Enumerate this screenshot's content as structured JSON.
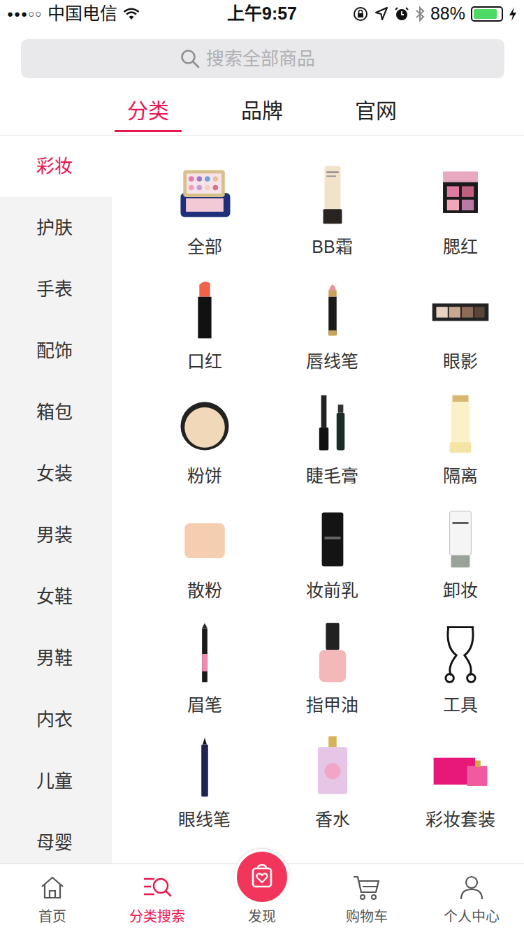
{
  "status_bar": {
    "signal": "●●●○○",
    "carrier": "中国电信",
    "time": "上午9:57",
    "battery": "88%",
    "battery_level": 0.88
  },
  "search": {
    "placeholder": "搜索全部商品"
  },
  "tabs": [
    {
      "label": "分类",
      "selected": true
    },
    {
      "label": "品牌",
      "selected": false
    },
    {
      "label": "官网",
      "selected": false
    }
  ],
  "sidebar": {
    "items": [
      {
        "label": "彩妆",
        "selected": true
      },
      {
        "label": "护肤",
        "selected": false
      },
      {
        "label": "手表",
        "selected": false
      },
      {
        "label": "配饰",
        "selected": false
      },
      {
        "label": "箱包",
        "selected": false
      },
      {
        "label": "女装",
        "selected": false
      },
      {
        "label": "男装",
        "selected": false
      },
      {
        "label": "女鞋",
        "selected": false
      },
      {
        "label": "男鞋",
        "selected": false
      },
      {
        "label": "内衣",
        "selected": false
      },
      {
        "label": "儿童",
        "selected": false
      },
      {
        "label": "母婴",
        "selected": false
      }
    ]
  },
  "categories": [
    {
      "label": "全部"
    },
    {
      "label": "BB霜"
    },
    {
      "label": "腮红"
    },
    {
      "label": "口红"
    },
    {
      "label": "唇线笔"
    },
    {
      "label": "眼影"
    },
    {
      "label": "粉饼"
    },
    {
      "label": "睫毛膏"
    },
    {
      "label": "隔离"
    },
    {
      "label": "散粉"
    },
    {
      "label": "妆前乳"
    },
    {
      "label": "卸妆"
    },
    {
      "label": "眉笔"
    },
    {
      "label": "指甲油"
    },
    {
      "label": "工具"
    },
    {
      "label": "眼线笔"
    },
    {
      "label": "香水"
    },
    {
      "label": "彩妆套装"
    }
  ],
  "bottom_nav": [
    {
      "label": "首页",
      "selected": false,
      "kind": "tab"
    },
    {
      "label": "分类搜索",
      "selected": true,
      "kind": "tab"
    },
    {
      "label": "发现",
      "selected": false,
      "kind": "raised"
    },
    {
      "label": "购物车",
      "selected": false,
      "kind": "tab"
    },
    {
      "label": "个人中心",
      "selected": false,
      "kind": "tab"
    }
  ]
}
